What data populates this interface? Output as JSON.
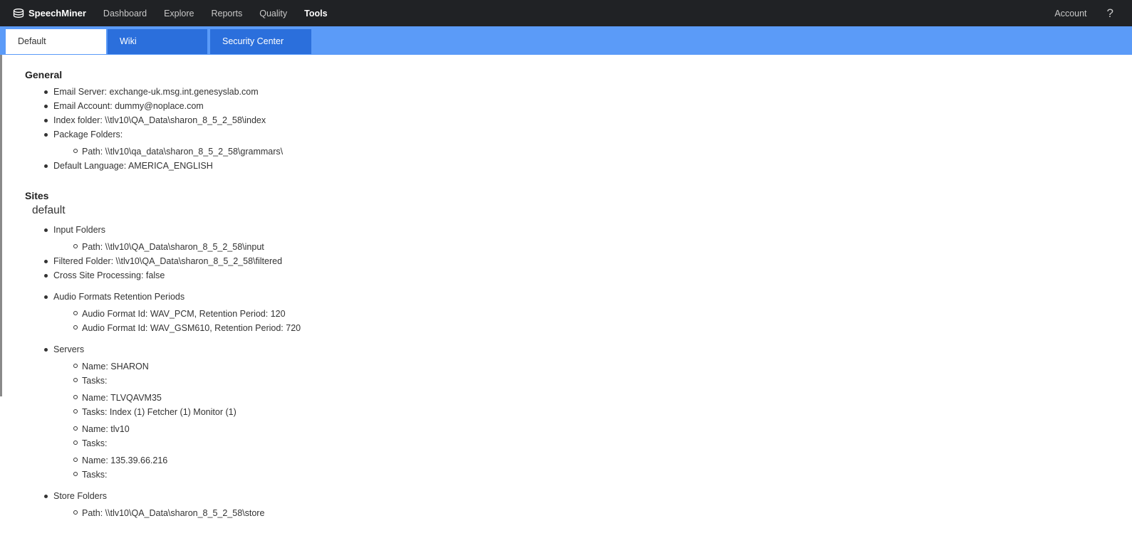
{
  "topbar": {
    "brand": "SpeechMiner",
    "brand_icon": "database-icon",
    "nav": [
      "Dashboard",
      "Explore",
      "Reports",
      "Quality",
      "Tools"
    ],
    "active_nav": "Tools",
    "account": "Account",
    "help": "?"
  },
  "tabs": [
    "Default",
    "Wiki",
    "Security Center"
  ],
  "general": {
    "title": "General",
    "email_server": "Email Server: exchange-uk.msg.int.genesyslab.com",
    "email_account": "Email Account: dummy@noplace.com",
    "index_folder": "Index folder: \\\\tlv10\\QA_Data\\sharon_8_5_2_58\\index",
    "package_folders": "Package Folders:",
    "package_path": "Path: \\\\tlv10\\qa_data\\sharon_8_5_2_58\\grammars\\",
    "default_language": "Default Language: AMERICA_ENGLISH"
  },
  "sites": {
    "title": "Sites",
    "site_name": "default",
    "input_folders": "Input Folders",
    "input_path": "Path: \\\\tlv10\\QA_Data\\sharon_8_5_2_58\\input",
    "filtered_folder": "Filtered Folder: \\\\tlv10\\QA_Data\\sharon_8_5_2_58\\filtered",
    "cross_site": "Cross Site Processing: false",
    "audio_retention": "Audio Formats Retention Periods",
    "audio_formats": [
      "Audio Format Id: WAV_PCM, Retention Period: 120",
      "Audio Format Id: WAV_GSM610, Retention Period: 720"
    ],
    "servers_label": "Servers",
    "servers": [
      {
        "name": "Name: SHARON",
        "tasks": "Tasks:"
      },
      {
        "name": "Name: TLVQAVM35",
        "tasks": "Tasks: Index (1) Fetcher (1) Monitor (1)"
      },
      {
        "name": "Name: tlv10",
        "tasks": "Tasks:"
      },
      {
        "name": "Name: 135.39.66.216",
        "tasks": "Tasks:"
      }
    ],
    "store_folders": "Store Folders",
    "store_path": "Path: \\\\tlv10\\QA_Data\\sharon_8_5_2_58\\store"
  }
}
